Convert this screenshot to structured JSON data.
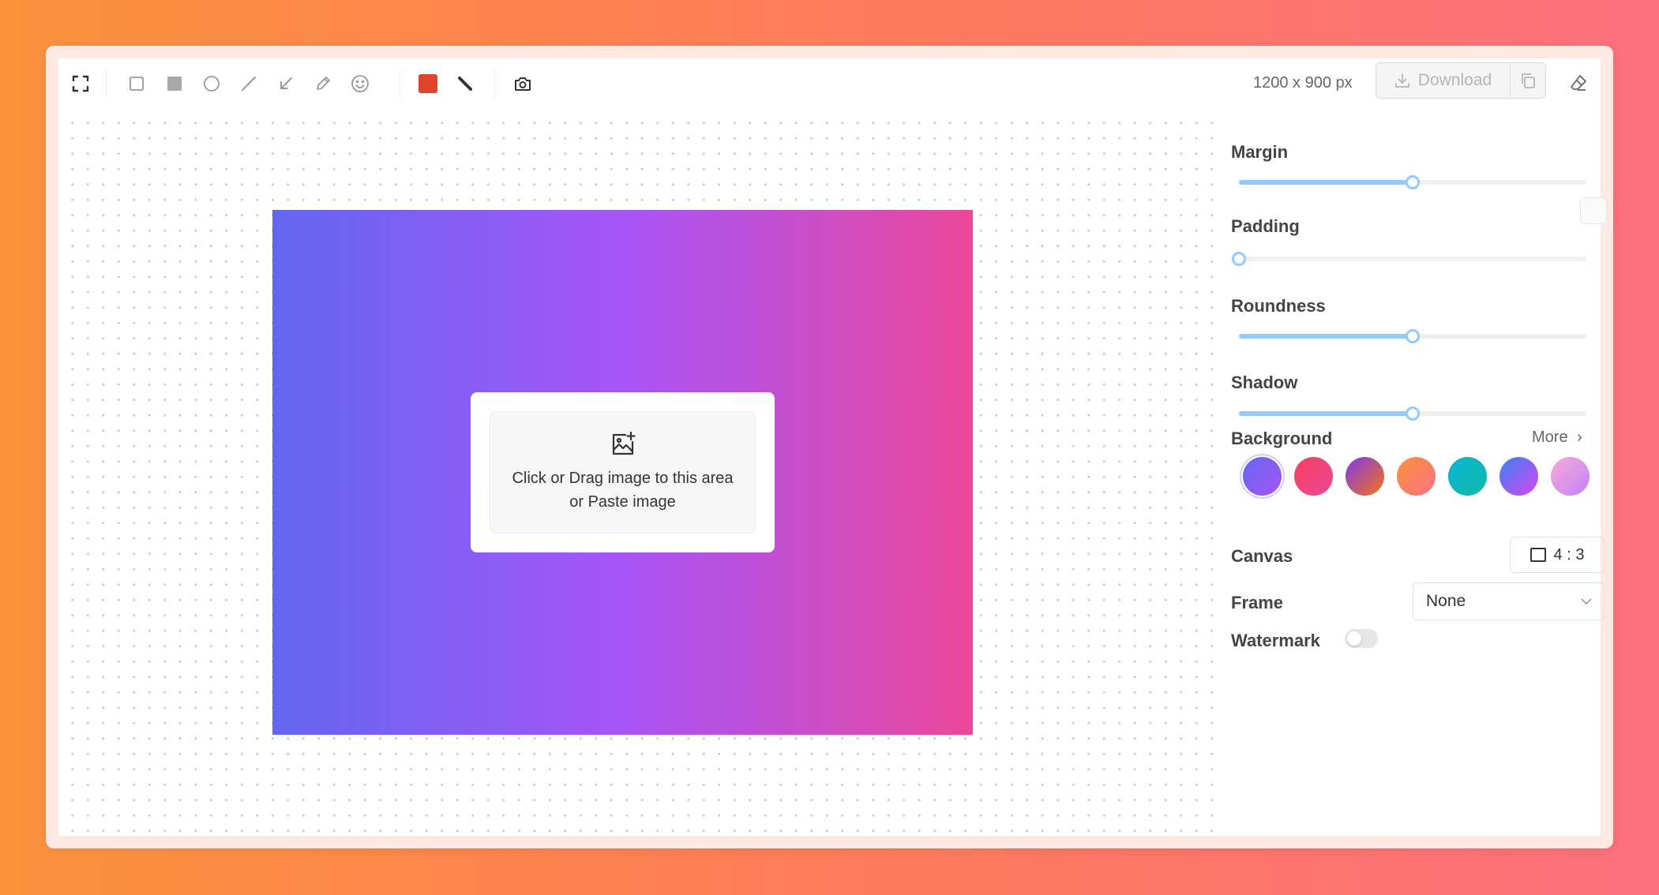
{
  "toolbar": {
    "tools": [
      {
        "name": "fullscreen-icon"
      },
      {
        "name": "rectangle-outline-icon"
      },
      {
        "name": "rectangle-filled-icon"
      },
      {
        "name": "circle-icon"
      },
      {
        "name": "line-icon"
      },
      {
        "name": "arrow-icon"
      },
      {
        "name": "pencil-icon"
      },
      {
        "name": "emoji-icon"
      },
      {
        "name": "color-picker-icon"
      },
      {
        "name": "stroke-width-icon"
      },
      {
        "name": "camera-icon"
      }
    ],
    "active_color": "#e0452c",
    "canvas_size": "1200 x 900 px",
    "download_label": "Download"
  },
  "dropzone": {
    "line1": "Click or Drag image to this area",
    "line2": "or Paste image"
  },
  "sidebar": {
    "margin_label": "Margin",
    "margin_value": 0.5,
    "padding_label": "Padding",
    "padding_value": 0,
    "roundness_label": "Roundness",
    "roundness_value": 0.5,
    "shadow_label": "Shadow",
    "shadow_value": 0.5,
    "background_label": "Background",
    "more_label": "More",
    "swatch_gradients": [
      "linear-gradient(135deg, #6366f1, #a855f7)",
      "linear-gradient(135deg, #f43f5e, #ec4899)",
      "linear-gradient(135deg, #7c3aed, #f97316)",
      "linear-gradient(135deg, #fb923c, #fb7185)",
      "linear-gradient(135deg, #06b6d4, #14b8a6)",
      "linear-gradient(135deg, #3b82f6, #d946ef)",
      "linear-gradient(135deg, #f9a8d4, #c084fc)"
    ],
    "canvas_label": "Canvas",
    "canvas_ratio": "4 : 3",
    "frame_label": "Frame",
    "frame_value": "None",
    "watermark_label": "Watermark",
    "watermark_on": false
  }
}
